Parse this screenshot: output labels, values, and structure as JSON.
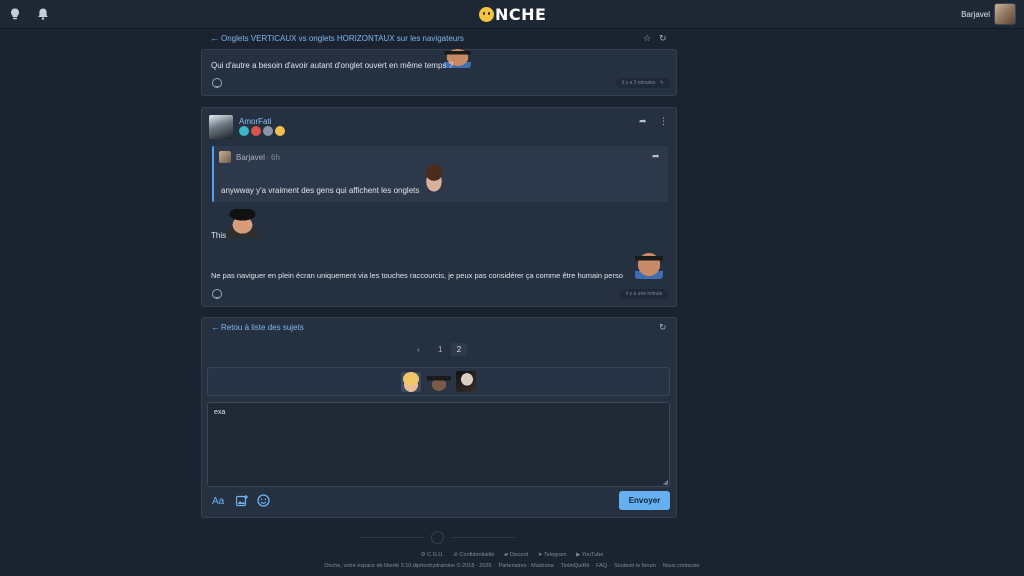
{
  "header": {
    "logo_text": "NCHE",
    "username": "Barjavel",
    "icons": [
      "lightbulb-icon",
      "bell-icon"
    ]
  },
  "topic": {
    "title": "Onglets VERTICAUX vs onglets HORIZONTAUX sur les navigateurs"
  },
  "posts": [
    {
      "text": "Qui d'autre a besoin d'avoir autant d'onglet ouvert en même temps ?",
      "time": "il y a 3 minutes"
    },
    {
      "author": "AmorFati",
      "quote": {
        "author": "Barjavel",
        "time": "6h",
        "text": "anywway y'a vraiment des gens qui affichent les onglets"
      },
      "line1": "This",
      "line2": "Ne pas naviguer en plein écran uniquement via les touches raccourcis, je peux pas considérer ça comme être humain perso",
      "time": "il y a une minute"
    }
  ],
  "nav": {
    "back_label": "Retou à liste des sujets",
    "prev_label": "‹",
    "pages": [
      "1",
      "2"
    ]
  },
  "reply": {
    "value": "exa",
    "send_label": "Envoyer",
    "format_label": "Aa"
  },
  "footer": {
    "links": [
      "C.G.U.",
      "Confidentialité",
      "Discord",
      "Telegram",
      "YouTube"
    ],
    "line": [
      "Onche, votre espace de liberté 3.10.diphenhydramine © 2018 - 2026",
      "Partenaires : Madzona",
      "TintinQuiRit",
      "FAQ",
      "Soutenir le forum",
      "Nous contacter"
    ]
  },
  "colors": {
    "background": "#1b2330",
    "card": "#253041",
    "accent": "#66b0f0",
    "quote_border": "#4fa3f1"
  }
}
